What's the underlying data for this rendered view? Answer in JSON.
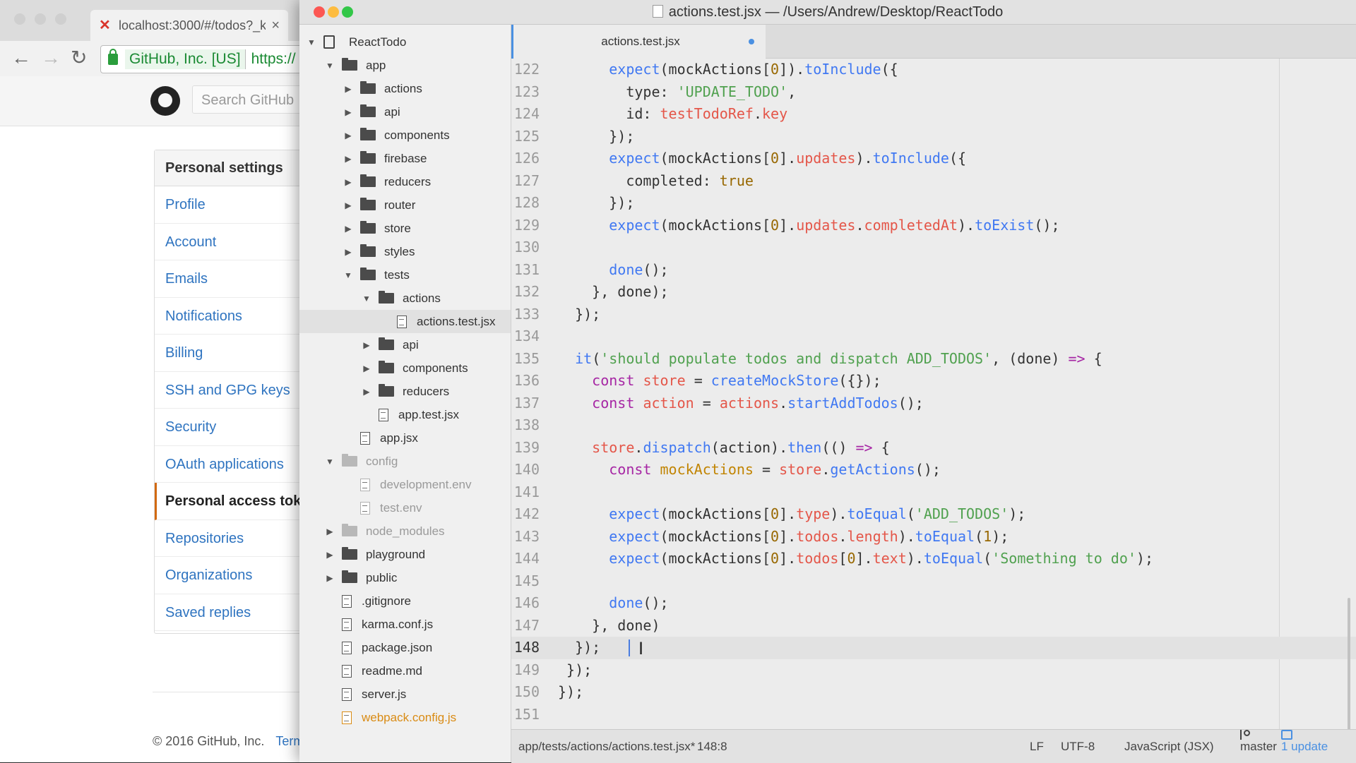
{
  "browser": {
    "tab_title": "localhost:3000/#/todos?_k",
    "ev_label": "GitHub, Inc. [US]",
    "url_prefix": "https://",
    "search_placeholder": "Search GitHub",
    "nav_header": "Personal settings",
    "nav_items": [
      "Profile",
      "Account",
      "Emails",
      "Notifications",
      "Billing",
      "SSH and GPG keys",
      "Security",
      "OAuth applications",
      "Personal access tokens",
      "Repositories",
      "Organizations",
      "Saved replies"
    ],
    "footer_copyright": "© 2016 GitHub, Inc.",
    "footer_link": "Terms"
  },
  "editor": {
    "window_title": "actions.test.jsx — /Users/Andrew/Desktop/ReactTodo",
    "active_tab": "actions.test.jsx",
    "tree": [
      {
        "label": "ReactTodo",
        "kind": "root",
        "depth": 0
      },
      {
        "label": "app",
        "kind": "folder",
        "open": true,
        "depth": 1
      },
      {
        "label": "actions",
        "kind": "folder",
        "depth": 2
      },
      {
        "label": "api",
        "kind": "folder",
        "depth": 2
      },
      {
        "label": "components",
        "kind": "folder",
        "depth": 2
      },
      {
        "label": "firebase",
        "kind": "folder",
        "depth": 2
      },
      {
        "label": "reducers",
        "kind": "folder",
        "depth": 2
      },
      {
        "label": "router",
        "kind": "folder",
        "depth": 2
      },
      {
        "label": "store",
        "kind": "folder",
        "depth": 2
      },
      {
        "label": "styles",
        "kind": "folder",
        "depth": 2
      },
      {
        "label": "tests",
        "kind": "folder",
        "open": true,
        "depth": 2
      },
      {
        "label": "actions",
        "kind": "folder",
        "open": true,
        "depth": 3
      },
      {
        "label": "actions.test.jsx",
        "kind": "file",
        "depth": 4,
        "selected": true
      },
      {
        "label": "api",
        "kind": "folder",
        "depth": 3
      },
      {
        "label": "components",
        "kind": "folder",
        "depth": 3
      },
      {
        "label": "reducers",
        "kind": "folder",
        "depth": 3
      },
      {
        "label": "app.test.jsx",
        "kind": "file",
        "depth": 3
      },
      {
        "label": "app.jsx",
        "kind": "file",
        "depth": 2
      },
      {
        "label": "config",
        "kind": "folder",
        "open": true,
        "depth": 1,
        "muted": true
      },
      {
        "label": "development.env",
        "kind": "file",
        "depth": 2,
        "muted": true
      },
      {
        "label": "test.env",
        "kind": "file",
        "depth": 2,
        "muted": true
      },
      {
        "label": "node_modules",
        "kind": "folder",
        "depth": 1,
        "muted": true
      },
      {
        "label": "playground",
        "kind": "folder",
        "depth": 1
      },
      {
        "label": "public",
        "kind": "folder",
        "depth": 1
      },
      {
        "label": ".gitignore",
        "kind": "file",
        "depth": 1
      },
      {
        "label": "karma.conf.js",
        "kind": "file",
        "depth": 1
      },
      {
        "label": "package.json",
        "kind": "file",
        "depth": 1
      },
      {
        "label": "readme.md",
        "kind": "file",
        "depth": 1
      },
      {
        "label": "server.js",
        "kind": "file",
        "depth": 1
      },
      {
        "label": "webpack.config.js",
        "kind": "file",
        "depth": 1,
        "modified": true
      }
    ],
    "current_line": 148,
    "lines": [
      {
        "n": 122,
        "html": "      <span class=\"t-fn\">expect</span>(mockActions[<span class=\"t-num\">0</span>]).<span class=\"t-fn\">toInclude</span>({"
      },
      {
        "n": 123,
        "html": "        type: <span class=\"t-str\">'UPDATE_TODO'</span>,"
      },
      {
        "n": 124,
        "html": "        id: <span class=\"t-prop\">testTodoRef</span>.<span class=\"t-prop\">key</span>"
      },
      {
        "n": 125,
        "html": "      });"
      },
      {
        "n": 126,
        "html": "      <span class=\"t-fn\">expect</span>(mockActions[<span class=\"t-num\">0</span>].<span class=\"t-prop\">updates</span>).<span class=\"t-fn\">toInclude</span>({"
      },
      {
        "n": 127,
        "html": "        completed: <span class=\"t-num\">true</span>"
      },
      {
        "n": 128,
        "html": "      });"
      },
      {
        "n": 129,
        "html": "      <span class=\"t-fn\">expect</span>(mockActions[<span class=\"t-num\">0</span>].<span class=\"t-prop\">updates</span>.<span class=\"t-prop\">completedAt</span>).<span class=\"t-fn\">toExist</span>();"
      },
      {
        "n": 130,
        "html": ""
      },
      {
        "n": 131,
        "html": "      <span class=\"t-fn\">done</span>();"
      },
      {
        "n": 132,
        "html": "    }, done);"
      },
      {
        "n": 133,
        "html": "  });"
      },
      {
        "n": 134,
        "html": ""
      },
      {
        "n": 135,
        "html": "  <span class=\"t-fn\">it</span>(<span class=\"t-str\">'should populate todos and dispatch ADD_TODOS'</span>, (done) <span class=\"t-kw\">=&gt;</span> {"
      },
      {
        "n": 136,
        "html": "    <span class=\"t-kw\">const</span> <span class=\"t-prop\">store</span> = <span class=\"t-fn\">createMockStore</span>({});"
      },
      {
        "n": 137,
        "html": "    <span class=\"t-kw\">const</span> <span class=\"t-prop\">action</span> = <span class=\"t-prop\">actions</span>.<span class=\"t-fn\">startAddTodos</span>();"
      },
      {
        "n": 138,
        "html": ""
      },
      {
        "n": 139,
        "html": "    <span class=\"t-prop\">store</span>.<span class=\"t-fn\">dispatch</span>(action).<span class=\"t-fn\">then</span>(() <span class=\"t-kw\">=&gt;</span> {"
      },
      {
        "n": 140,
        "html": "      <span class=\"t-kw\">const</span> <span class=\"t-ty\">mockActions</span> = <span class=\"t-prop\">store</span>.<span class=\"t-fn\">getActions</span>();"
      },
      {
        "n": 141,
        "html": ""
      },
      {
        "n": 142,
        "html": "      <span class=\"t-fn\">expect</span>(mockActions[<span class=\"t-num\">0</span>].<span class=\"t-prop\">type</span>).<span class=\"t-fn\">toEqual</span>(<span class=\"t-str\">'ADD_TODOS'</span>);"
      },
      {
        "n": 143,
        "html": "      <span class=\"t-fn\">expect</span>(mockActions[<span class=\"t-num\">0</span>].<span class=\"t-prop\">todos</span>.<span class=\"t-prop\">length</span>).<span class=\"t-fn\">toEqual</span>(<span class=\"t-num\">1</span>);"
      },
      {
        "n": 144,
        "html": "      <span class=\"t-fn\">expect</span>(mockActions[<span class=\"t-num\">0</span>].<span class=\"t-prop\">todos</span>[<span class=\"t-num\">0</span>].<span class=\"t-prop\">text</span>).<span class=\"t-fn\">toEqual</span>(<span class=\"t-str\">'Something to do'</span>);"
      },
      {
        "n": 145,
        "html": ""
      },
      {
        "n": 146,
        "html": "      <span class=\"t-fn\">done</span>();"
      },
      {
        "n": 147,
        "html": "    }, done)"
      },
      {
        "n": 148,
        "html": "  });"
      },
      {
        "n": 149,
        "html": " });"
      },
      {
        "n": 150,
        "html": "});"
      },
      {
        "n": 151,
        "html": ""
      }
    ],
    "status": {
      "path": "app/tests/actions/actions.test.jsx*",
      "cursor": "148:8",
      "line_ending": "LF",
      "encoding": "UTF-8",
      "grammar": "JavaScript (JSX)",
      "branch": "master",
      "updates": "1 update"
    }
  },
  "colors": {
    "accent": "#4a90e2",
    "modified": "#d98b14",
    "close": "#fc5753",
    "minimize": "#fdbc40",
    "zoom": "#33c748"
  }
}
